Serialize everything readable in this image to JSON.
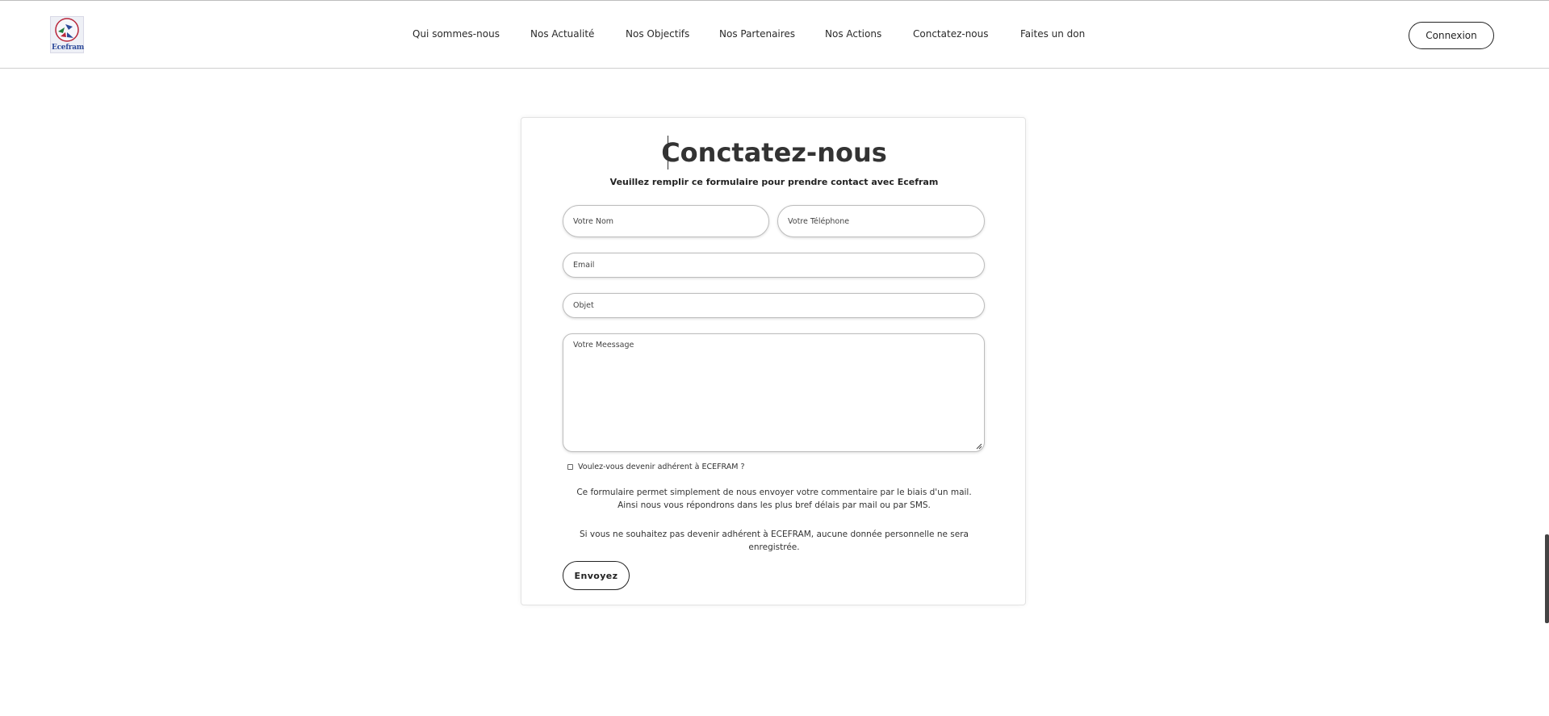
{
  "header": {
    "logo_text": "Ecefram",
    "nav": [
      {
        "label": "Qui sommes-nous"
      },
      {
        "label": "Nos Actualité"
      },
      {
        "label": "Nos Objectifs"
      },
      {
        "label": "Nos Partenaires"
      },
      {
        "label": "Nos Actions"
      },
      {
        "label": "Conctatez-nous"
      },
      {
        "label": "Faites un don"
      }
    ],
    "login_label": "Connexion"
  },
  "form": {
    "title": "Conctatez-nous",
    "subtitle": "Veuillez remplir ce formulaire pour prendre contact avec Ecefram",
    "name_placeholder": "Votre Nom",
    "phone_placeholder": "Votre Téléphone",
    "email_placeholder": "Email",
    "subject_placeholder": "Objet",
    "message_placeholder": "Votre Meessage",
    "member_checkbox_label": "Voulez-vous devenir adhérent à ECEFRAM ?",
    "member_checkbox_checked": false,
    "info_1": "Ce formulaire permet simplement de nous envoyer votre commentaire par le biais d'un mail. Ainsi nous vous répondrons dans les plus bref délais par mail ou par SMS.",
    "info_2": "Si vous ne souhaitez pas devenir adhérent à ECEFRAM, aucune donnée personnelle ne sera enregistrée.",
    "submit_label": "Envoyez"
  },
  "colors": {
    "text": "#222222",
    "logo_text": "#2d4a9a",
    "border": "#bdbdbd"
  }
}
